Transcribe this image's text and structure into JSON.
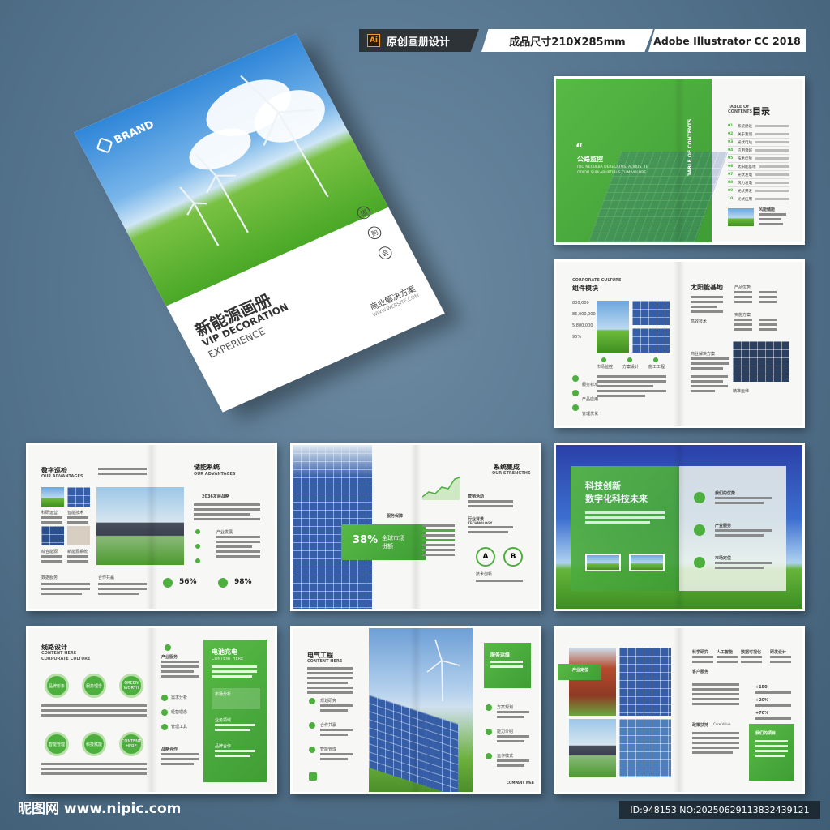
{
  "header": {
    "ai_badge": "Ai",
    "label_original": "原创画册设计",
    "label_size": "成品尺寸210X285mm",
    "label_software": "Adobe Illustrator CC 2018"
  },
  "cover": {
    "brand": "BRAND",
    "title": "新能源画册",
    "subtitle1": "VIP DECORATION",
    "subtitle2": "EXPERIENCE",
    "icon_labels": [
      "团",
      "购",
      "会"
    ],
    "business": "商业解决方案",
    "website": "WWW.WEBSITE.COM"
  },
  "spread_toc": {
    "quote_title": "公路监控",
    "quote_text": "ITIO NECULBA DERECATUS. ALIBUS. TE ODION SUM ARUPTIBUS CUM VOLORE",
    "toc_label": "TABLE OF CONTENTS",
    "toc_title": "目录",
    "side_text": "TABLE OF CONTENTS",
    "items": [
      "系统建设",
      "关于我们",
      "光伏电站",
      "应用领域",
      "技术优势",
      "太阳能基地",
      "光伏发电",
      "风力发电",
      "光伏开发",
      "光伏应用"
    ],
    "thumb_label": "风能储能"
  },
  "spread_culture": {
    "eyebrow": "CORPORATE CULTURE",
    "title": "组件模块",
    "stats": [
      "800,000",
      "86,000,000",
      "5,800,000",
      "95%"
    ],
    "right_title": "太阳能基地",
    "labels": [
      "产品优势",
      "实施方案",
      "高效技术",
      "商业解决方案",
      "精准运维"
    ],
    "mid_labels": [
      "市场监控",
      "方案设计",
      "施工工程"
    ],
    "left_labels": [
      "服务标准",
      "产品应用",
      "管理优化"
    ]
  },
  "spread_digital": {
    "title_left": "数字巡检",
    "sub_left": "OUR ADVANTAGES",
    "title_right": "储能系统",
    "sub_right": "OUR ADVANTAGES",
    "strategy": "2036发展战略",
    "pct1": "56%",
    "pct2": "98%",
    "labels": [
      "科研运营",
      "智能技术",
      "综合能源",
      "新能源系统",
      "数据服务",
      "合作共赢",
      "产业发展"
    ]
  },
  "spread_system": {
    "title": "系统集成",
    "sub": "OUR STRENGTHS",
    "pct": "38%",
    "pct_label": "全球市场",
    "pct_label2": "份额",
    "service": "服务保障",
    "labels": [
      "营销活动",
      "行业背景",
      "TECHNOLOGY",
      "技术创新"
    ],
    "ab": [
      "A",
      "B"
    ]
  },
  "spread_tech": {
    "title1": "科技创新",
    "title2": "数字化科技未来",
    "items": [
      "我们的优势",
      "产业服务",
      "市场定位"
    ]
  },
  "spread_route": {
    "title": "线路设计",
    "sub1": "CONTENT HERE",
    "sub2": "CORPORATE CULTURE",
    "mid_head": "产业服务",
    "mid_items": [
      "需求分析",
      "经营理念",
      "管理工具"
    ],
    "mid_foot": "战略合作",
    "panel_title": "电池充电",
    "panel_sub": "CONTENT HERE",
    "panel_items": [
      "市场分析",
      "业务领域",
      "品牌合作"
    ],
    "circles": [
      "品牌形象",
      "CONTENT HERE",
      "服务理念",
      "GREEN WORTH",
      "智能管理",
      "科技赋能"
    ]
  },
  "spread_power": {
    "title": "电气工程",
    "sub": "CONTENT HERE",
    "left_items": [
      "规划研究",
      "合作共赢",
      "智能管理"
    ],
    "box": "服务运维",
    "right_items": [
      "方案规划",
      "能力介绍",
      "运作模式"
    ],
    "footer": "COMPANY WEB"
  },
  "spread_products": {
    "tabs": [
      "科学研究",
      "人工智能",
      "数据可视化",
      "研发设计"
    ],
    "head": "客户服务",
    "badge": "产业定位",
    "stats": [
      "+150",
      "+20%",
      "+70%"
    ],
    "label": "政策扶持",
    "label_sub": "Core Value",
    "panel": "我们的项目"
  },
  "footer": {
    "watermark": "昵图网 www.nipic.com",
    "id": "ID:948153 NO:20250629113832439121"
  }
}
